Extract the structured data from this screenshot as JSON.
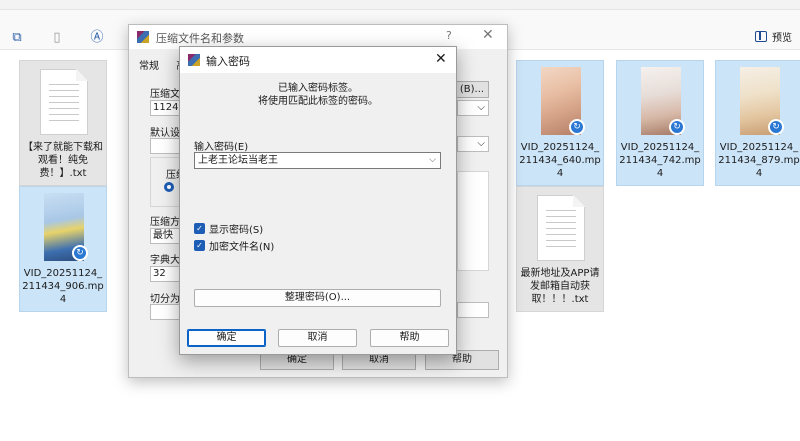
{
  "toolbar": {
    "preview_label": "预览"
  },
  "files": [
    {
      "name": "【来了就能下载和观看！纯免费！】.txt",
      "kind": "doc"
    },
    {
      "name": "VID_20251124_211434_906.mp4",
      "kind": "video"
    },
    {
      "name": "VID_20251124_211434_640.mp4",
      "kind": "video"
    },
    {
      "name": "VID_20251124_211434_742.mp4",
      "kind": "video"
    },
    {
      "name": "VID_20251124_211434_879.mp4",
      "kind": "video"
    },
    {
      "name": "最新地址及APP请发邮箱自动获取！！！.txt",
      "kind": "doc"
    }
  ],
  "archive_dialog": {
    "title": "压缩文件名和参数",
    "help": "?",
    "tab_general": "常规",
    "tab_fragment": "高",
    "label_archive_name": "压缩文件",
    "archive_name_value": "1124yu",
    "browse_label": "(B)...",
    "label_default_profile": "默认设置",
    "label_format": "压缩文",
    "label_method": "压缩方",
    "method_value": "最快",
    "label_dict": "字典大小",
    "dict_value": "32",
    "label_split": "切分为分",
    "ok_label": "确定",
    "cancel_label": "取消",
    "help_label": "帮助"
  },
  "password_dialog": {
    "title": "输入密码",
    "info_line1": "已输入密码标签。",
    "info_line2": "将使用匹配此标签的密码。",
    "label_password": "输入密码(E)",
    "password_value": "上老王论坛当老王",
    "show_password_label": "显示密码(S)",
    "show_password_checked": true,
    "encrypt_names_label": "加密文件名(N)",
    "encrypt_names_checked": true,
    "organize_label": "整理密码(O)...",
    "ok_label": "确定",
    "cancel_label": "取消",
    "help_label": "帮助"
  }
}
